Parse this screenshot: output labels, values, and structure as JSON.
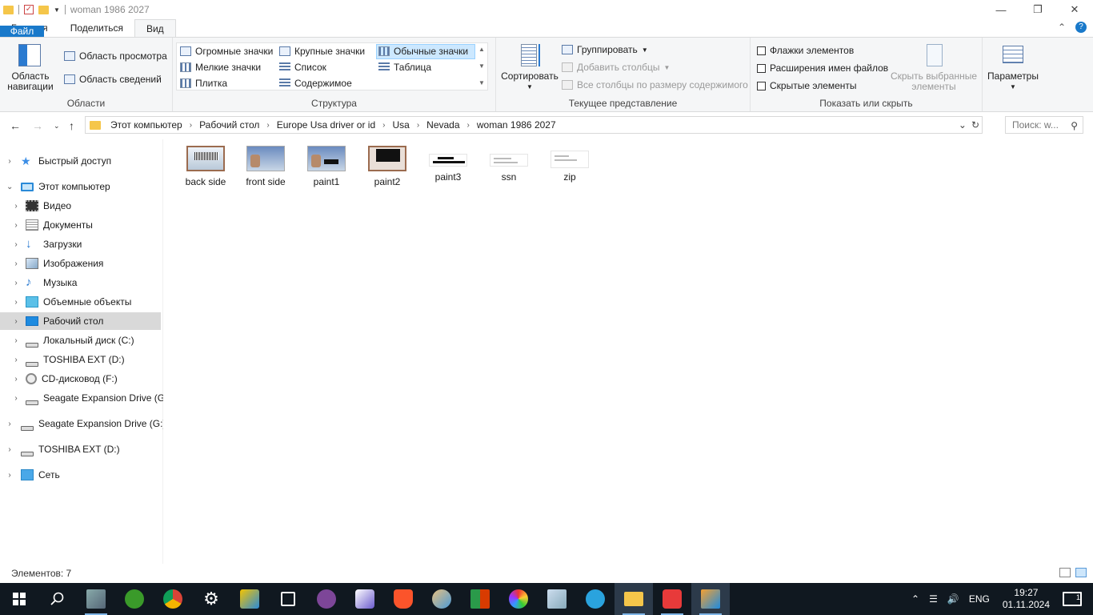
{
  "window": {
    "title": "woman 1986 2027",
    "controls": [
      "minimize",
      "maximize",
      "close"
    ]
  },
  "ribbon_tabs": [
    {
      "label": "Файл",
      "active": false
    },
    {
      "label": "Главная",
      "active": false
    },
    {
      "label": "Поделиться",
      "active": false
    },
    {
      "label": "Вид",
      "active": true
    }
  ],
  "ribbon": {
    "panes": {
      "label": "Области",
      "nav_pane": "Область навигации",
      "preview_pane": "Область просмотра",
      "details_pane": "Область сведений"
    },
    "layout": {
      "label": "Структура",
      "items": [
        "Огромные значки",
        "Крупные значки",
        "Обычные значки",
        "Мелкие значки",
        "Список",
        "Таблица",
        "Плитка",
        "Содержимое"
      ],
      "selected": "Обычные значки"
    },
    "current_view": {
      "label": "Текущее представление",
      "sort": "Сортировать",
      "group": "Группировать",
      "add_columns": "Добавить столбцы",
      "fit_columns": "Все столбцы по размеру содержимого"
    },
    "show_hide": {
      "label": "Показать или скрыть",
      "checkboxes": [
        {
          "label": "Флажки элементов",
          "checked": false
        },
        {
          "label": "Расширения имен файлов",
          "checked": false
        },
        {
          "label": "Скрытые элементы",
          "checked": false
        }
      ],
      "hide_selected": "Скрыть выбранные элементы"
    },
    "options": "Параметры"
  },
  "address": {
    "crumbs": [
      "Этот компьютер",
      "Рабочий стол",
      "Europe Usa driver or id",
      "Usa",
      "Nevada",
      "woman 1986 2027"
    ],
    "search_placeholder": "Поиск: w..."
  },
  "sidebar": [
    {
      "label": "Быстрый доступ",
      "icon": "star-icon",
      "level": 0
    },
    {
      "label": "Этот компьютер",
      "icon": "computer-icon",
      "level": 0,
      "expanded": true
    },
    {
      "label": "Видео",
      "icon": "video-icon",
      "level": 1
    },
    {
      "label": "Документы",
      "icon": "documents-icon",
      "level": 1
    },
    {
      "label": "Загрузки",
      "icon": "downloads-icon",
      "level": 1
    },
    {
      "label": "Изображения",
      "icon": "pictures-icon",
      "level": 1
    },
    {
      "label": "Музыка",
      "icon": "music-icon",
      "level": 1
    },
    {
      "label": "Объемные объекты",
      "icon": "3d-objects-icon",
      "level": 1
    },
    {
      "label": "Рабочий стол",
      "icon": "desktop-icon",
      "level": 1,
      "selected": true
    },
    {
      "label": "Локальный диск (C:)",
      "icon": "local-disk-icon",
      "level": 1
    },
    {
      "label": "TOSHIBA EXT (D:)",
      "icon": "drive-icon",
      "level": 1
    },
    {
      "label": "CD-дисковод (F:)",
      "icon": "cd-drive-icon",
      "level": 1
    },
    {
      "label": "Seagate Expansion Drive (G:)",
      "icon": "drive-icon",
      "level": 1
    },
    {
      "label": "Seagate Expansion Drive (G:)",
      "icon": "drive-icon",
      "level": 0
    },
    {
      "label": "TOSHIBA EXT (D:)",
      "icon": "drive-icon",
      "level": 0
    },
    {
      "label": "Сеть",
      "icon": "network-icon",
      "level": 0
    }
  ],
  "files": [
    {
      "name": "back side",
      "thumb": "card"
    },
    {
      "name": "front side",
      "thumb": "front"
    },
    {
      "name": "paint1",
      "thumb": "front"
    },
    {
      "name": "paint2",
      "thumb": "p2"
    },
    {
      "name": "paint3",
      "thumb": "white-black"
    },
    {
      "name": "ssn",
      "thumb": "white"
    },
    {
      "name": "zip",
      "thumb": "white"
    }
  ],
  "status": {
    "items": "Элементов: 7"
  },
  "taskbar": {
    "apps": [
      "start-icon",
      "search-icon",
      "photos-app-icon",
      "utorrent-icon",
      "chrome-icon",
      "settings-icon",
      "keys-app-icon",
      "snip-app-icon",
      "tor-app-icon",
      "q-app-icon",
      "brave-icon",
      "paint-app-icon",
      "office-app-icon",
      "color-app-icon",
      "notes-app-icon",
      "telegram-icon",
      "file-explorer-icon",
      "gimp-icon",
      "media-player-icon"
    ],
    "lang": "ENG",
    "time": "19:27",
    "date": "01.11.2024",
    "notifications": "1"
  },
  "colors": {
    "accent": "#1979ca",
    "selected_bg": "#cce8ff",
    "taskbar": "#101820"
  }
}
